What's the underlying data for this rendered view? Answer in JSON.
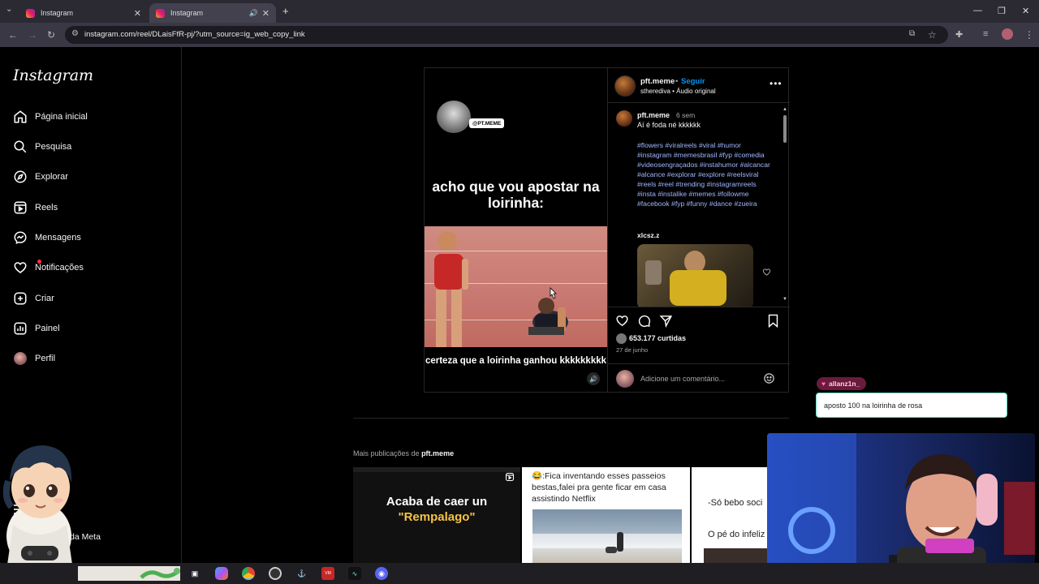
{
  "browser": {
    "tabs": [
      {
        "title": "Instagram",
        "close": "✕"
      },
      {
        "title": "Instagram",
        "close": "✕"
      }
    ],
    "new_tab": "+",
    "url": "instagram.com/reel/DLaisFfR-pj/?utm_source=ig_web_copy_link"
  },
  "sidebar": {
    "logo": "Instagram",
    "items": [
      {
        "label": "Página inicial",
        "icon": "home-icon"
      },
      {
        "label": "Pesquisa",
        "icon": "search-icon"
      },
      {
        "label": "Explorar",
        "icon": "compass-icon"
      },
      {
        "label": "Reels",
        "icon": "reels-icon"
      },
      {
        "label": "Mensagens",
        "icon": "messenger-icon"
      },
      {
        "label": "Notificações",
        "icon": "heart-icon"
      },
      {
        "label": "Criar",
        "icon": "plus-square-icon"
      },
      {
        "label": "Painel",
        "icon": "dashboard-icon"
      },
      {
        "label": "Perfil",
        "icon": "avatar"
      }
    ],
    "meta_label": "da Meta"
  },
  "post": {
    "video": {
      "watermark": "@PT.MEME",
      "caption_top": "acho que vou apostar na loirinha:",
      "caption_bottom": "certeza que a loirinha ganhou kkkkkkkkk"
    },
    "header": {
      "username": "pft.meme",
      "follow": "Seguir",
      "separator": "•",
      "audio": "stherediva • Áudio original"
    },
    "caption": {
      "username": "pft.meme",
      "time": "6 sem",
      "text": "Aí é foda né kkkkkk",
      "hashtags": "#flowers #viralreels #viral #humor #instagram #memesbrasil #fyp #comedia #videosengraçados #instahumor #alcancar #alcance #explorar #explore #reelsviral #reels #reel #trending #instagramreels #insta #instalike #memes #followme #facebook #fyp #funny #dance #zueira"
    },
    "comment": {
      "username": "xlcsz.z"
    },
    "likes": "653.177 curtidas",
    "date": "27 de junho",
    "add_comment_placeholder": "Adicione um comentário..."
  },
  "chat": {
    "username": "allanz1n_",
    "message": "aposto 100 na loirinha de rosa"
  },
  "more": {
    "prefix": "Mais publicações de",
    "username": "pft.meme",
    "thumbs": [
      {
        "line1": "Acaba de caer un",
        "line2": "\"Rempalago\""
      },
      {
        "text": "😂:Fica inventando esses passeios bestas,falei pra gente ficar em casa assistindo Netflix"
      },
      {
        "line1": "-Só bebo soci",
        "line2": "O pé do infeliz"
      }
    ]
  },
  "taskbar": {
    "items": [
      "task-view-icon",
      "copilot-icon",
      "chrome-icon",
      "obs-icon",
      "app-icon",
      "voicemeeter-icon",
      "wave-icon",
      "discord-icon"
    ]
  }
}
